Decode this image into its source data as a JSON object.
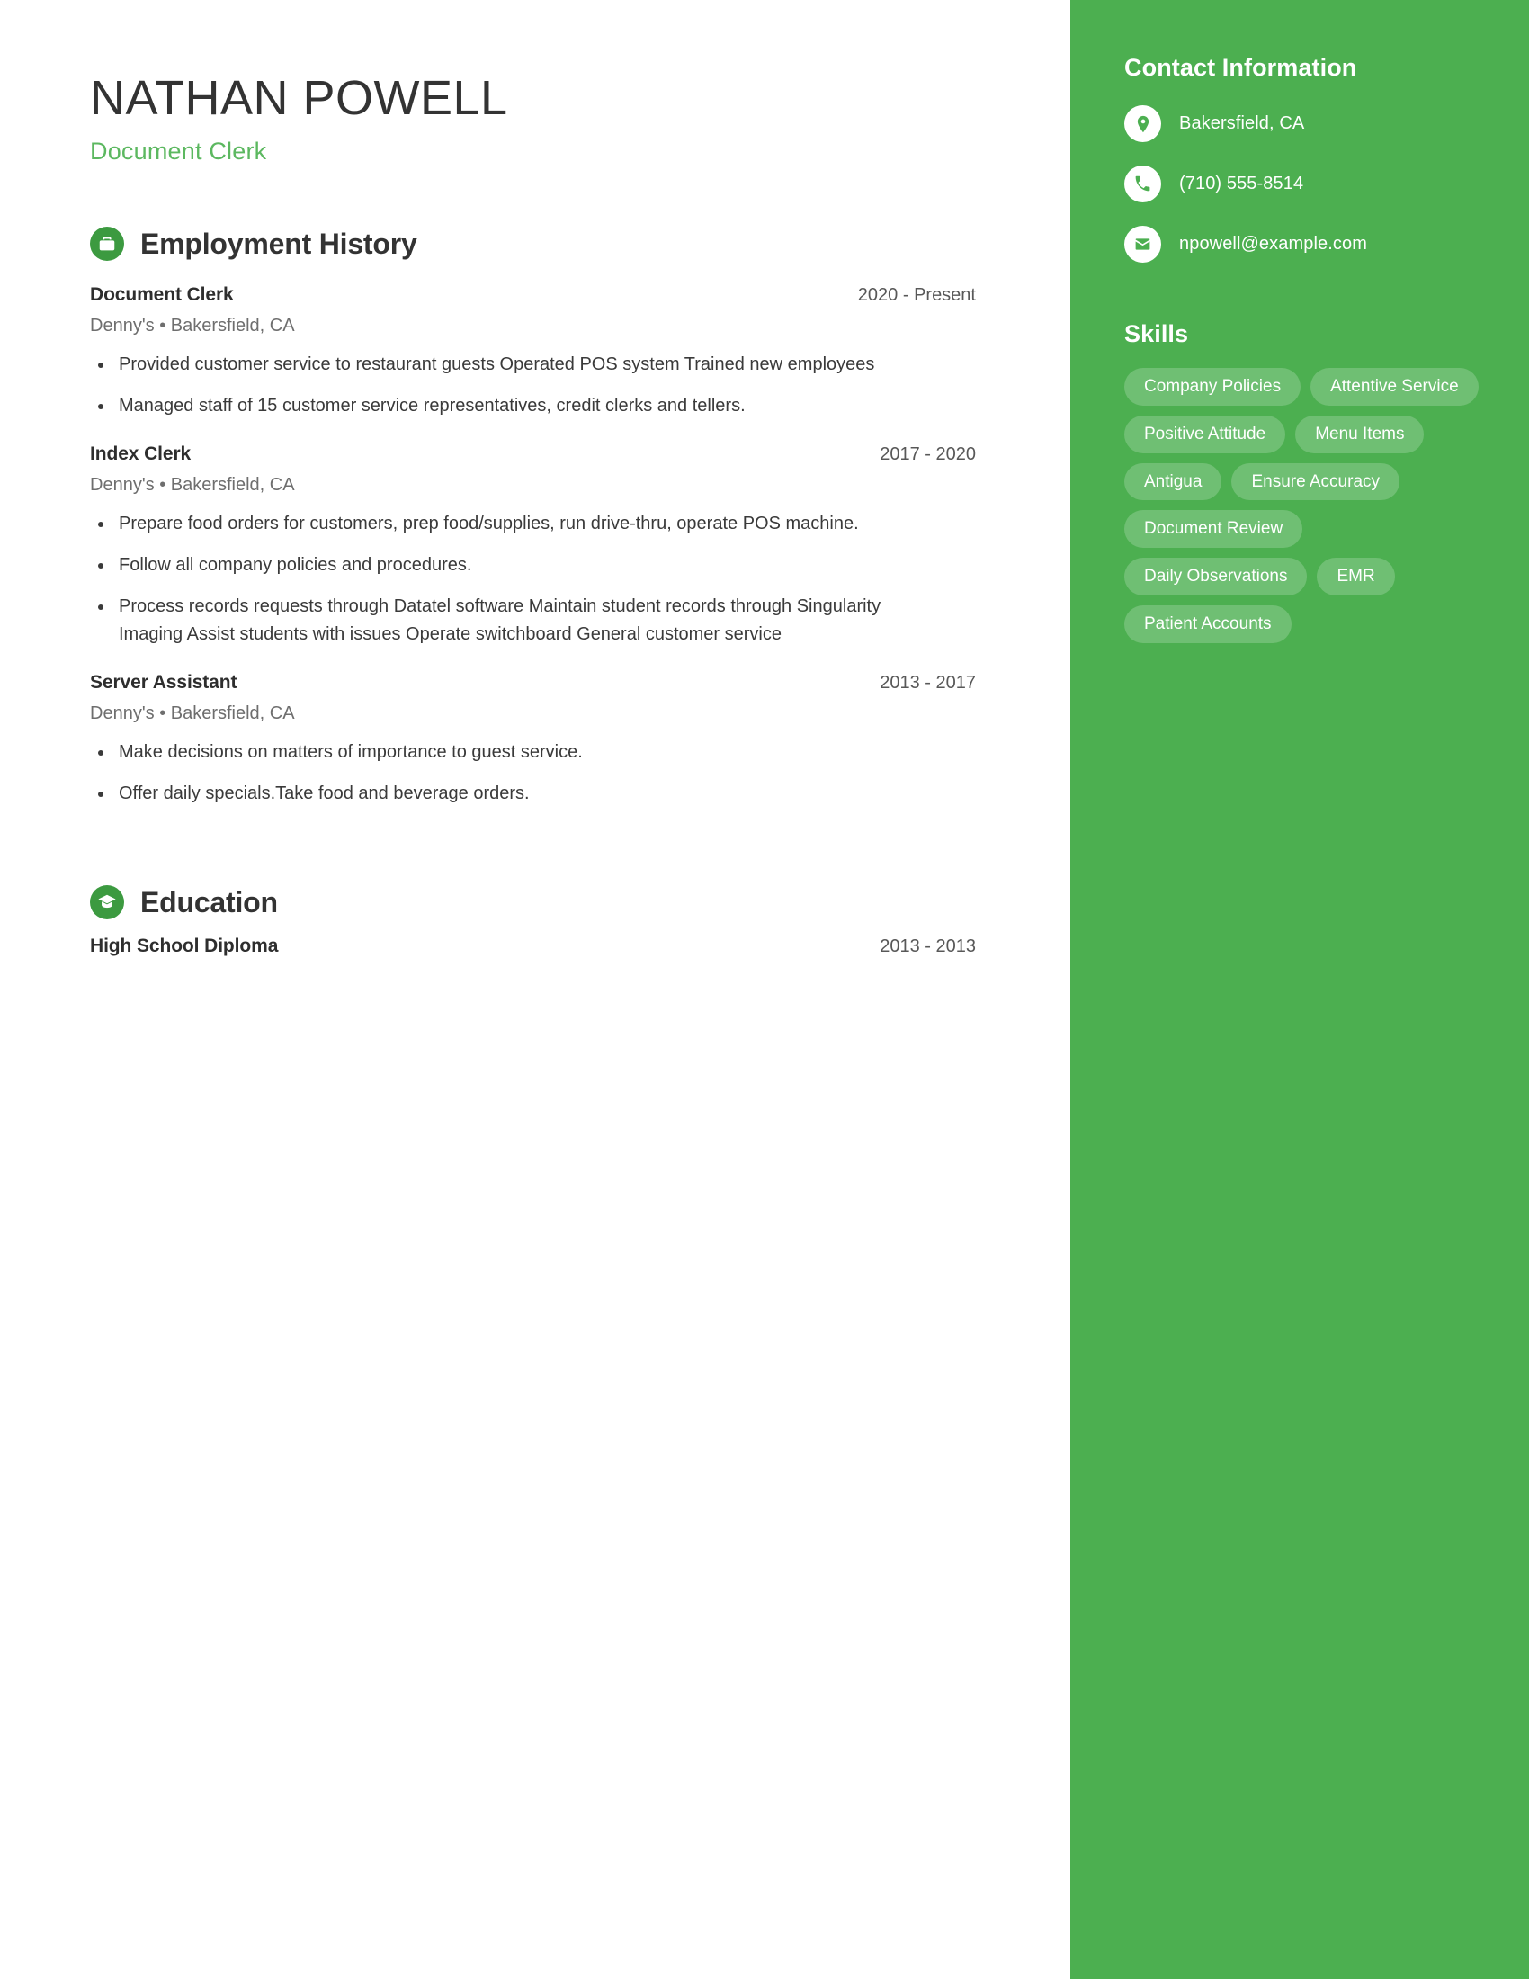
{
  "header": {
    "name": "NATHAN POWELL",
    "subtitle": "Document Clerk"
  },
  "colors": {
    "sidebar_green": "#4CAF50",
    "icon_green": "#3C9A40",
    "subtitle_green": "#5CB860",
    "pill_bg": "rgba(255,255,255,0.20)",
    "text_dark": "#333333"
  },
  "sections": {
    "employment": {
      "title": "Employment History",
      "icon": "briefcase-icon",
      "entries": [
        {
          "title": "Document Clerk",
          "date": "2020 - Present",
          "meta": "Denny's  •  Bakersfield, CA",
          "bullets": [
            "Provided customer service to restaurant guests Operated POS system Trained new employees",
            "Managed staff of 15 customer service representatives, credit clerks and tellers."
          ]
        },
        {
          "title": "Index Clerk",
          "date": "2017 - 2020",
          "meta": "Denny's  •  Bakersfield, CA",
          "bullets": [
            "Prepare food orders for customers, prep food/supplies, run drive-thru, operate POS machine.",
            "Follow all company policies and procedures.",
            "Process records requests through Datatel software Maintain student records through Singularity Imaging Assist students with issues Operate switchboard General customer service"
          ]
        },
        {
          "title": "Server Assistant",
          "date": "2013 - 2017",
          "meta": "Denny's  •  Bakersfield, CA",
          "bullets": [
            "Make decisions on matters of importance to guest service.",
            "Offer daily specials.Take food and beverage orders."
          ]
        }
      ]
    },
    "education": {
      "title": "Education",
      "icon": "graduation-cap-icon",
      "entries": [
        {
          "title": "High School Diploma",
          "date": "2013 - 2013"
        }
      ]
    }
  },
  "sidebar": {
    "contact": {
      "title": "Contact Information",
      "items": [
        {
          "icon": "location-pin-icon",
          "text": "Bakersfield, CA"
        },
        {
          "icon": "phone-icon",
          "text": "(710) 555-8514"
        },
        {
          "icon": "envelope-icon",
          "text": "npowell@example.com"
        }
      ]
    },
    "skills": {
      "title": "Skills",
      "items": [
        "Company Policies",
        "Attentive Service",
        "Positive Attitude",
        "Menu Items",
        "Antigua",
        "Ensure Accuracy",
        "Document Review",
        "Daily Observations",
        "EMR",
        "Patient Accounts"
      ]
    }
  }
}
